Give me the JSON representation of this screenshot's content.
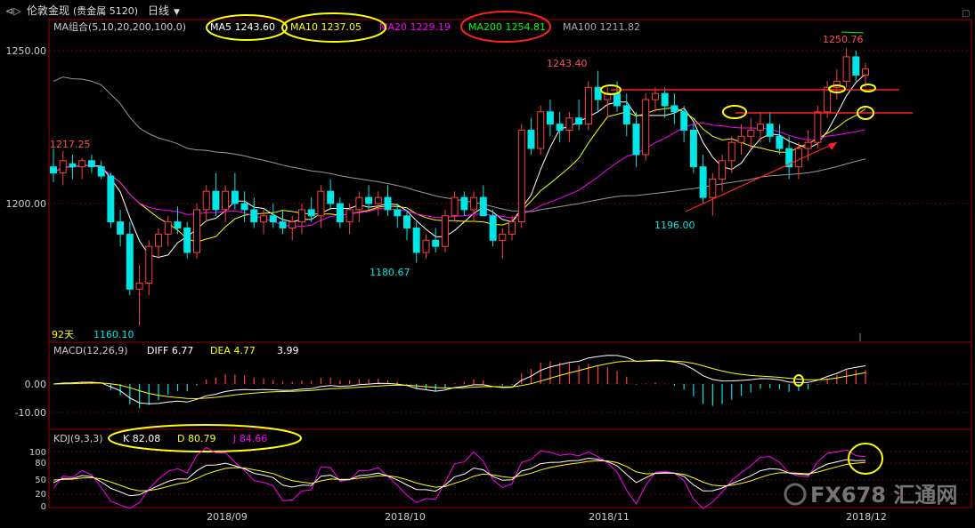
{
  "header": {
    "instrument": "伦敦金现",
    "exchange": "(贵金属 5120)",
    "period": "日线",
    "period_arrow": "▼"
  },
  "ma_legend": {
    "label": "MA组合(5,10,20,200,100,0)",
    "items": [
      {
        "text": "MA5 1243.60",
        "color": "#ffffff"
      },
      {
        "text": "MA10 1237.05",
        "color": "#ffff00"
      },
      {
        "text": "MA20 1229.19",
        "color": "#ff00ff"
      },
      {
        "text": "MA200 1254.81",
        "color": "#00ff00"
      },
      {
        "text": "MA100 1211.82",
        "color": "#aaaaaa"
      }
    ]
  },
  "macd_legend": {
    "label": "MACD(12,26,9)",
    "diff": "DIFF 6.77",
    "dea": "DEA 4.77",
    "macd": "3.99"
  },
  "kdj_legend": {
    "label": "KDJ(9,3,3)",
    "k": "K 82.08",
    "d": "D 80.79",
    "j": "J 84.66"
  },
  "annotations": {
    "days": "92天",
    "low1": "1160.10",
    "low2": "1180.67",
    "low3": "1196.00",
    "high1": "1217.25",
    "high2": "1243.40",
    "high3": "1250.76"
  },
  "watermark": "FX678 汇通网",
  "colors": {
    "up": "#ff4040",
    "down": "#00e5e5",
    "ma5": "#ffffff",
    "ma10": "#ffff00",
    "ma20": "#ff00ff",
    "ma100": "#999999",
    "grid": "#7a0000",
    "highlight_yellow": "#ffff00",
    "highlight_red": "#ff2020"
  },
  "chart_data": [
    {
      "type": "candlestick",
      "title": "伦敦金现 日线",
      "x_ticks": [
        "2018/09",
        "2018/10",
        "2018/11",
        "2018/12"
      ],
      "y_ticks": [
        1250.0,
        1200.0
      ],
      "ylim": [
        1157,
        1262
      ],
      "ohlc": [
        [
          1212,
          1218,
          1207,
          1210
        ],
        [
          1210,
          1217.25,
          1206,
          1214
        ],
        [
          1213,
          1216,
          1208,
          1212
        ],
        [
          1212,
          1215,
          1208,
          1214
        ],
        [
          1214,
          1216,
          1210,
          1212
        ],
        [
          1212,
          1214,
          1208,
          1209
        ],
        [
          1209,
          1210,
          1192,
          1194
        ],
        [
          1194,
          1198,
          1186,
          1190
        ],
        [
          1190,
          1194,
          1170,
          1172
        ],
        [
          1172,
          1180,
          1160.1,
          1174
        ],
        [
          1174,
          1188,
          1170,
          1186
        ],
        [
          1186,
          1192,
          1182,
          1190
        ],
        [
          1190,
          1196,
          1186,
          1194
        ],
        [
          1194,
          1199,
          1190,
          1192
        ],
        [
          1192,
          1194,
          1182,
          1184
        ],
        [
          1184,
          1200,
          1182,
          1198
        ],
        [
          1198,
          1206,
          1194,
          1204
        ],
        [
          1204,
          1210,
          1196,
          1198
        ],
        [
          1198,
          1206,
          1194,
          1204
        ],
        [
          1204,
          1210,
          1198,
          1200
        ],
        [
          1200,
          1204,
          1194,
          1198
        ],
        [
          1198,
          1202,
          1192,
          1194
        ],
        [
          1194,
          1198,
          1190,
          1196
        ],
        [
          1196,
          1200,
          1192,
          1194
        ],
        [
          1194,
          1198,
          1190,
          1192
        ],
        [
          1192,
          1196,
          1188,
          1194
        ],
        [
          1194,
          1200,
          1190,
          1198
        ],
        [
          1198,
          1202,
          1194,
          1196
        ],
        [
          1196,
          1206,
          1192,
          1204
        ],
        [
          1204,
          1208,
          1198,
          1200
        ],
        [
          1200,
          1202,
          1192,
          1194
        ],
        [
          1194,
          1200,
          1190,
          1198
        ],
        [
          1198,
          1204,
          1194,
          1202
        ],
        [
          1202,
          1206,
          1198,
          1200
        ],
        [
          1200,
          1204,
          1196,
          1202
        ],
        [
          1202,
          1206,
          1196,
          1198
        ],
        [
          1198,
          1200,
          1192,
          1196
        ],
        [
          1196,
          1198,
          1188,
          1192
        ],
        [
          1192,
          1194,
          1180.67,
          1184
        ],
        [
          1184,
          1190,
          1182,
          1188
        ],
        [
          1188,
          1192,
          1184,
          1186
        ],
        [
          1186,
          1198,
          1184,
          1196
        ],
        [
          1196,
          1204,
          1194,
          1202
        ],
        [
          1202,
          1204,
          1196,
          1198
        ],
        [
          1198,
          1204,
          1194,
          1202
        ],
        [
          1202,
          1206,
          1196,
          1196
        ],
        [
          1196,
          1198,
          1186,
          1188
        ],
        [
          1188,
          1192,
          1182,
          1190
        ],
        [
          1190,
          1196,
          1188,
          1194
        ],
        [
          1194,
          1226,
          1192,
          1224
        ],
        [
          1224,
          1228,
          1216,
          1218
        ],
        [
          1218,
          1232,
          1216,
          1230
        ],
        [
          1230,
          1234,
          1222,
          1226
        ],
        [
          1226,
          1230,
          1220,
          1224
        ],
        [
          1224,
          1230,
          1220,
          1228
        ],
        [
          1228,
          1234,
          1224,
          1226
        ],
        [
          1226,
          1240,
          1224,
          1238
        ],
        [
          1238,
          1243.4,
          1230,
          1234
        ],
        [
          1234,
          1238,
          1228,
          1236
        ],
        [
          1236,
          1240,
          1230,
          1232
        ],
        [
          1232,
          1236,
          1222,
          1226
        ],
        [
          1226,
          1230,
          1212,
          1216
        ],
        [
          1216,
          1236,
          1214,
          1234
        ],
        [
          1234,
          1238,
          1230,
          1236
        ],
        [
          1236,
          1238,
          1228,
          1232
        ],
        [
          1232,
          1236,
          1226,
          1230
        ],
        [
          1230,
          1232,
          1220,
          1224
        ],
        [
          1224,
          1226,
          1210,
          1212
        ],
        [
          1212,
          1216,
          1200,
          1202
        ],
        [
          1202,
          1210,
          1196,
          1208
        ],
        [
          1208,
          1216,
          1204,
          1214
        ],
        [
          1214,
          1222,
          1210,
          1220
        ],
        [
          1220,
          1226,
          1216,
          1222
        ],
        [
          1222,
          1228,
          1218,
          1224
        ],
        [
          1224,
          1230,
          1220,
          1226
        ],
        [
          1226,
          1230,
          1220,
          1222
        ],
        [
          1222,
          1226,
          1216,
          1218
        ],
        [
          1218,
          1222,
          1208,
          1212
        ],
        [
          1212,
          1220,
          1208,
          1218
        ],
        [
          1218,
          1224,
          1214,
          1220
        ],
        [
          1220,
          1232,
          1218,
          1230
        ],
        [
          1230,
          1240,
          1228,
          1238
        ],
        [
          1238,
          1244,
          1234,
          1240
        ],
        [
          1240,
          1250.76,
          1238,
          1248
        ],
        [
          1248,
          1250,
          1240,
          1242
        ],
        [
          1242,
          1246,
          1238,
          1244
        ]
      ]
    },
    {
      "type": "bar+line",
      "title": "MACD(12,26,9)",
      "y_ticks": [
        0.0,
        -10.0
      ],
      "series": [
        {
          "name": "DIFF",
          "last": 6.77
        },
        {
          "name": "DEA",
          "last": 4.77
        },
        {
          "name": "MACD",
          "last": 3.99
        }
      ]
    },
    {
      "type": "line",
      "title": "KDJ(9,3,3)",
      "y_ticks": [
        100,
        80,
        50,
        20,
        0
      ],
      "series": [
        {
          "name": "K",
          "last": 82.08
        },
        {
          "name": "D",
          "last": 80.79
        },
        {
          "name": "J",
          "last": 84.66
        }
      ]
    }
  ]
}
